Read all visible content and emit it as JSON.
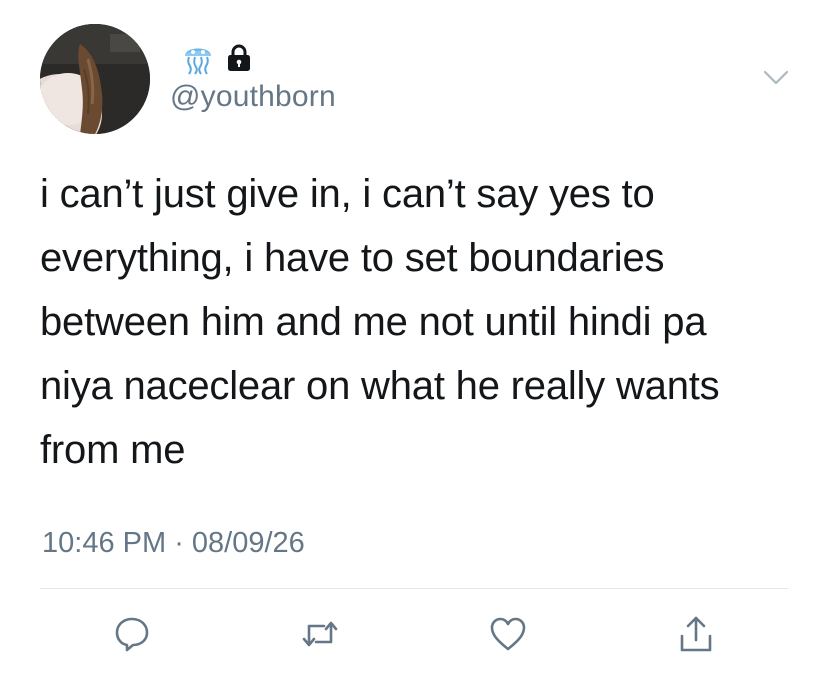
{
  "user": {
    "handle": "@youthborn",
    "name_emoji_icon": "jellyfish-emoji-icon",
    "protected_icon": "lock-icon",
    "avatar": "profile-photo"
  },
  "tweet": {
    "text": "i can’t just give in, i can’t say yes to\neverything, i have to set boundaries\nbetween him and me not until hindi pa\nniya naceclear on what he really wants\nfrom me",
    "time": "10:46 PM",
    "separator": " · ",
    "date": "08/09/26"
  },
  "actions": [
    {
      "name": "reply",
      "icon": "reply-icon"
    },
    {
      "name": "retweet",
      "icon": "retweet-icon"
    },
    {
      "name": "like",
      "icon": "heart-icon"
    },
    {
      "name": "share",
      "icon": "share-icon"
    }
  ],
  "colors": {
    "text": "#14171a",
    "secondary": "#657786",
    "icon": "#657786",
    "divider": "#e1e8ed",
    "background": "#ffffff"
  }
}
